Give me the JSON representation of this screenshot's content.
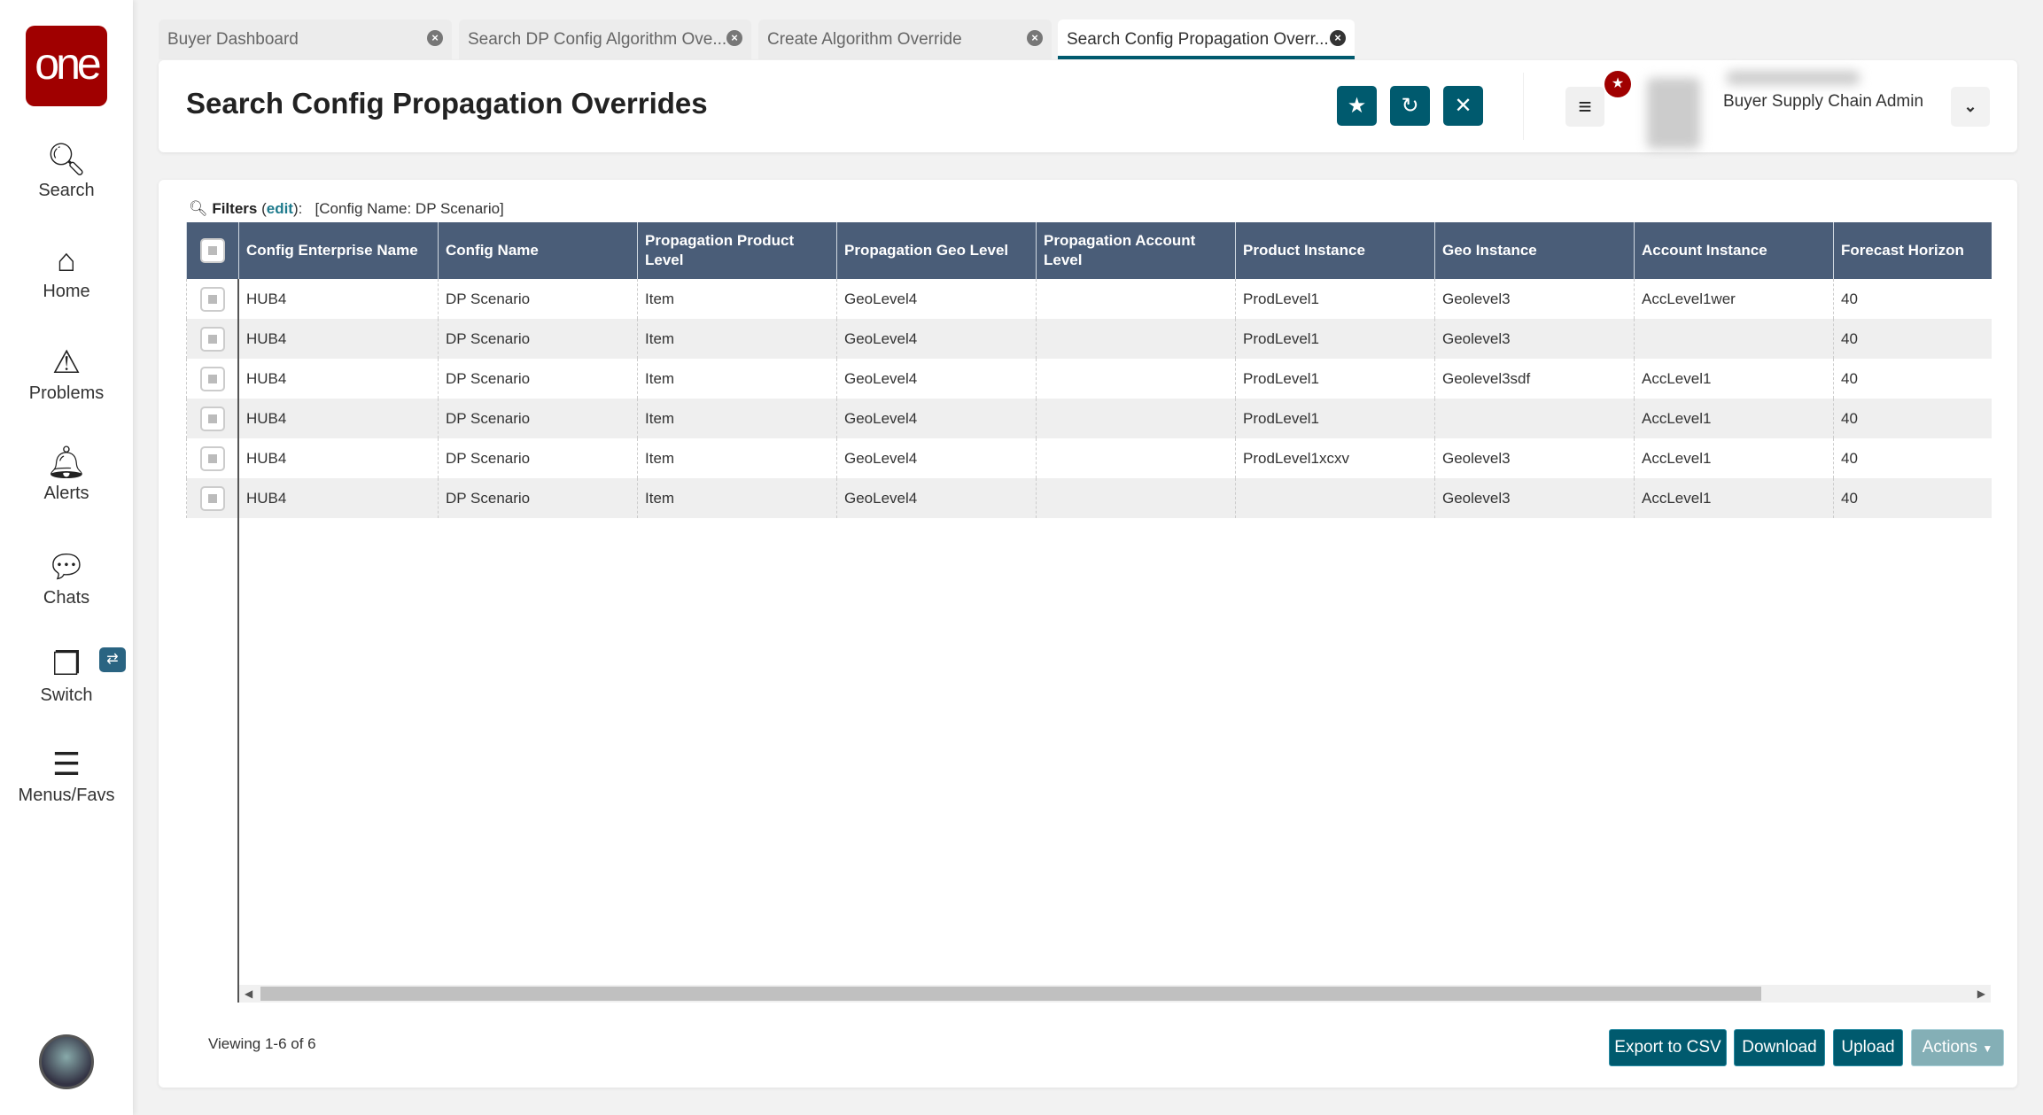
{
  "sidebar": {
    "logo": "one",
    "items": [
      {
        "label": "Search"
      },
      {
        "label": "Home"
      },
      {
        "label": "Problems"
      },
      {
        "label": "Alerts"
      },
      {
        "label": "Chats"
      },
      {
        "label": "Switch"
      },
      {
        "label": "Menus/Favs"
      }
    ]
  },
  "tabs": [
    {
      "label": "Buyer Dashboard"
    },
    {
      "label": "Search DP Config Algorithm Ove..."
    },
    {
      "label": "Create Algorithm Override"
    },
    {
      "label": "Search Config Propagation Overr..."
    }
  ],
  "header": {
    "title": "Search Config Propagation Overrides",
    "role": "Buyer Supply Chain Admin"
  },
  "filters": {
    "label": "Filters",
    "edit": "edit",
    "value": "[Config Name: DP Scenario]"
  },
  "table": {
    "columns": [
      "Config Enterprise Name",
      "Config Name",
      "Propagation Product Level",
      "Propagation Geo Level",
      "Propagation Account Level",
      "Product Instance",
      "Geo Instance",
      "Account Instance",
      "Forecast Horizon"
    ],
    "rows": [
      [
        "HUB4",
        "DP Scenario",
        "Item",
        "GeoLevel4",
        "",
        "ProdLevel1",
        "Geolevel3",
        "AccLevel1wer",
        "40"
      ],
      [
        "HUB4",
        "DP Scenario",
        "Item",
        "GeoLevel4",
        "",
        "ProdLevel1",
        "Geolevel3",
        "",
        "40"
      ],
      [
        "HUB4",
        "DP Scenario",
        "Item",
        "GeoLevel4",
        "",
        "ProdLevel1",
        "Geolevel3sdf",
        "AccLevel1",
        "40"
      ],
      [
        "HUB4",
        "DP Scenario",
        "Item",
        "GeoLevel4",
        "",
        "ProdLevel1",
        "",
        "AccLevel1",
        "40"
      ],
      [
        "HUB4",
        "DP Scenario",
        "Item",
        "GeoLevel4",
        "",
        "ProdLevel1xcxv",
        "Geolevel3",
        "AccLevel1",
        "40"
      ],
      [
        "HUB4",
        "DP Scenario",
        "Item",
        "GeoLevel4",
        "",
        "",
        "Geolevel3",
        "AccLevel1",
        "40"
      ]
    ]
  },
  "footer": {
    "viewing": "Viewing 1-6 of 6",
    "export": "Export to CSV",
    "download": "Download",
    "upload": "Upload",
    "actions": "Actions"
  }
}
